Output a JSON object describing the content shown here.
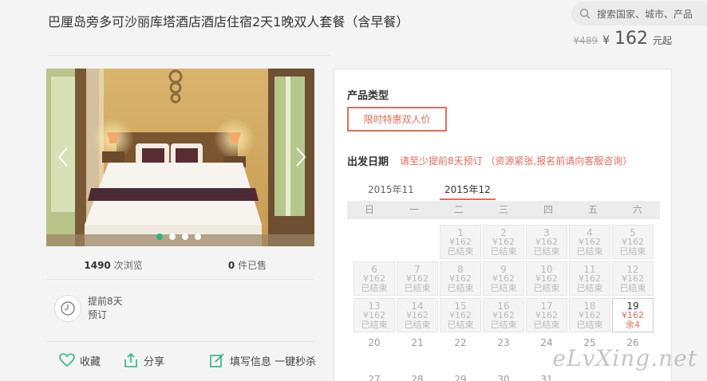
{
  "header": {
    "title": "巴厘岛旁多可沙丽库塔酒店酒店住宿2天1晚双人套餐（含早餐）",
    "search_placeholder": "搜索国家、城市、产品",
    "old_price": "¥489",
    "currency": "¥",
    "price": "162",
    "price_unit": "元起"
  },
  "gallery": {
    "active_index": 0,
    "dot_count": 4
  },
  "stats": {
    "views_num": "1490",
    "views_label": "次浏览",
    "sold_num": "0",
    "sold_label": "件已售"
  },
  "booking": {
    "advance_line1": "提前8天",
    "advance_line2": "预订"
  },
  "actions": {
    "favorite": "收藏",
    "share": "分享",
    "fill_info": "填写信息 一键秒杀"
  },
  "panel": {
    "product_type_label": "产品类型",
    "product_type_option": "限时特惠双人价",
    "date_label": "出发日期",
    "date_note": "请至少提前8天预订 （资源紧张,报名前请向客服咨询）",
    "month_tabs": [
      "2015年11",
      "2015年12"
    ],
    "weekdays": [
      "日",
      "一",
      "二",
      "三",
      "四",
      "五",
      "六"
    ],
    "cells": [
      {
        "day": "1",
        "price": "¥162",
        "status": "已结束"
      },
      {
        "day": "2",
        "price": "¥162",
        "status": "已结束"
      },
      {
        "day": "3",
        "price": "¥162",
        "status": "已结束"
      },
      {
        "day": "4",
        "price": "¥162",
        "status": "已结束"
      },
      {
        "day": "5",
        "price": "¥162",
        "status": "已结束"
      },
      {
        "day": "6",
        "price": "¥162",
        "status": "已结束"
      },
      {
        "day": "7",
        "price": "¥162",
        "status": "已结束"
      },
      {
        "day": "8",
        "price": "¥162",
        "status": "已结束"
      },
      {
        "day": "9",
        "price": "¥162",
        "status": "已结束"
      },
      {
        "day": "10",
        "price": "¥162",
        "status": "已结束"
      },
      {
        "day": "11",
        "price": "¥162",
        "status": "已结束"
      },
      {
        "day": "12",
        "price": "¥162",
        "status": "已结束"
      },
      {
        "day": "13",
        "price": "¥162",
        "status": "已结束"
      },
      {
        "day": "14",
        "price": "¥162",
        "status": "已结束"
      },
      {
        "day": "15",
        "price": "¥162",
        "status": "已结束"
      },
      {
        "day": "16",
        "price": "¥162",
        "status": "已结束"
      },
      {
        "day": "17",
        "price": "¥162",
        "status": "已结束"
      },
      {
        "day": "18",
        "price": "¥162",
        "status": "已结束"
      },
      {
        "day": "19",
        "price": "¥162",
        "status": "余4"
      }
    ],
    "plain_days": [
      "20",
      "21",
      "22",
      "23",
      "24",
      "25",
      "26",
      "27",
      "28",
      "29",
      "30",
      "31"
    ]
  },
  "watermark": "eLvXing.net"
}
